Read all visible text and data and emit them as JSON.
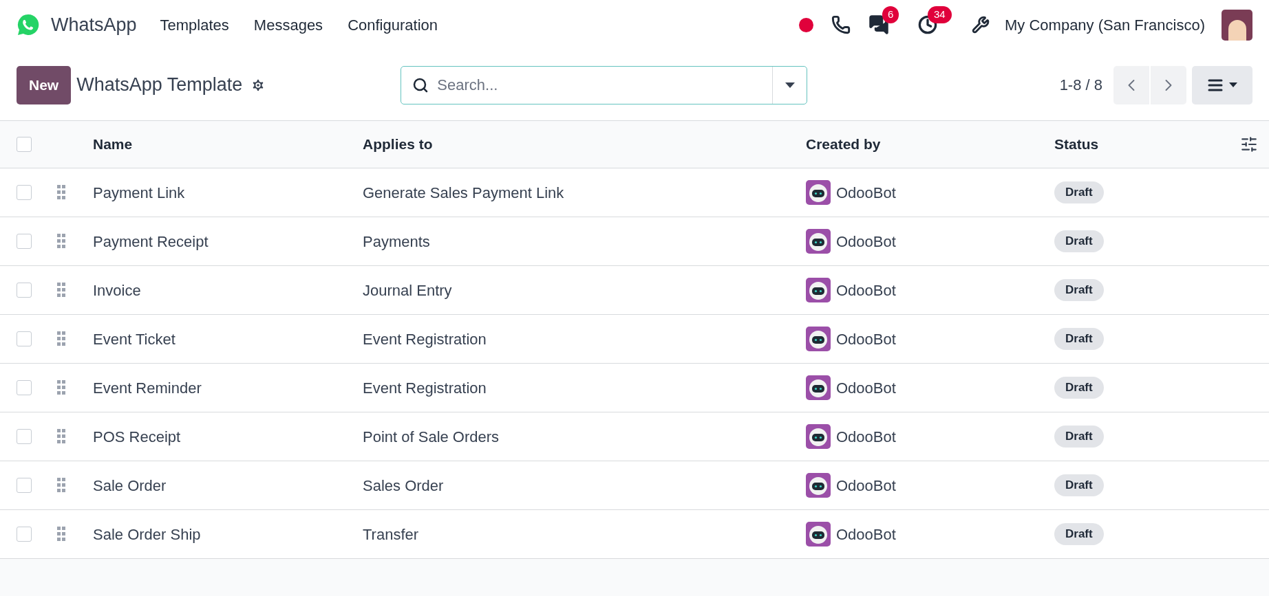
{
  "navbar": {
    "app_name": "WhatsApp",
    "menu": [
      "Templates",
      "Messages",
      "Configuration"
    ],
    "messages_count": "6",
    "activities_count": "34",
    "company": "My Company (San Francisco)"
  },
  "control_panel": {
    "new_button": "New",
    "title": "WhatsApp Template",
    "search": {
      "placeholder": "Search..."
    },
    "pager": "1-8 / 8"
  },
  "table": {
    "select_all": {
      "checked": false
    },
    "columns": [
      "Name",
      "Applies to",
      "Created by",
      "Status"
    ],
    "rows": [
      {
        "name": "Payment Link",
        "applies_to": "Generate Sales Payment Link",
        "created_by": "OdooBot",
        "status": "Draft",
        "checked": false
      },
      {
        "name": "Payment Receipt",
        "applies_to": "Payments",
        "created_by": "OdooBot",
        "status": "Draft",
        "checked": false
      },
      {
        "name": "Invoice",
        "applies_to": "Journal Entry",
        "created_by": "OdooBot",
        "status": "Draft",
        "checked": false
      },
      {
        "name": "Event Ticket",
        "applies_to": "Event Registration",
        "created_by": "OdooBot",
        "status": "Draft",
        "checked": false
      },
      {
        "name": "Event Reminder",
        "applies_to": "Event Registration",
        "created_by": "OdooBot",
        "status": "Draft",
        "checked": false
      },
      {
        "name": "POS Receipt",
        "applies_to": "Point of Sale Orders",
        "created_by": "OdooBot",
        "status": "Draft",
        "checked": false
      },
      {
        "name": "Sale Order",
        "applies_to": "Sales Order",
        "created_by": "OdooBot",
        "status": "Draft",
        "checked": false
      },
      {
        "name": "Sale Order Ship",
        "applies_to": "Transfer",
        "created_by": "OdooBot",
        "status": "Draft",
        "checked": false
      }
    ]
  }
}
